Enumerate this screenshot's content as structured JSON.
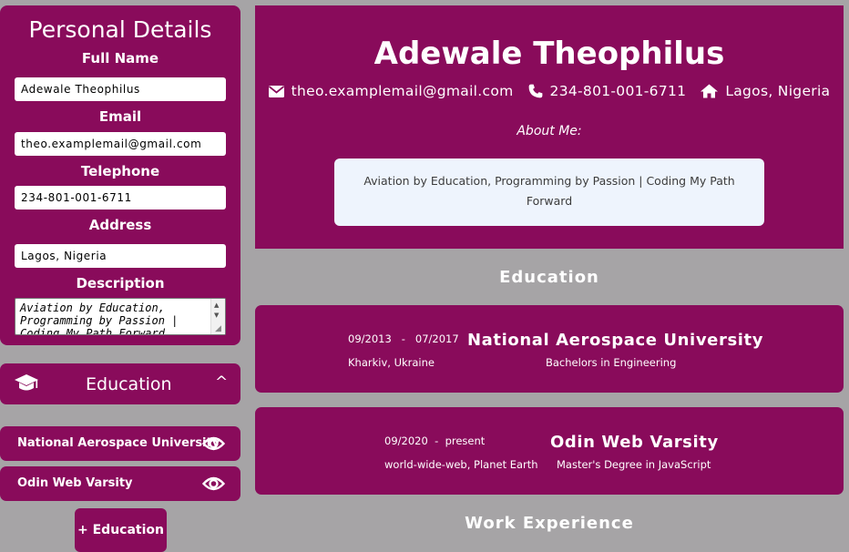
{
  "form": {
    "title": "Personal Details",
    "full_name_label": "Full Name",
    "full_name_value": "Adewale Theophilus",
    "email_label": "Email",
    "email_value": "theo.examplemail@gmail.com",
    "telephone_label": "Telephone",
    "telephone_value": "234-801-001-6711",
    "address_label": "Address",
    "address_value": "Lagos, Nigeria",
    "description_label": "Description",
    "description_value": "Aviation by Education, Programming by Passion | Coding My Path Forward"
  },
  "education_panel": {
    "header_label": "Education",
    "collapse_glyph": "^",
    "items": [
      {
        "label": "National Aerospace University"
      },
      {
        "label": "Odin Web Varsity"
      }
    ],
    "add_button_label": "+ Education"
  },
  "preview": {
    "name": "Adewale Theophilus",
    "email": "theo.examplemail@gmail.com",
    "phone": "234-801-001-6711",
    "address": "Lagos, Nigeria",
    "about_label": "About Me:",
    "about_text": "Aviation by Education, Programming by Passion | Coding My Path Forward",
    "education_title": "Education",
    "work_title": "Work Experience",
    "education": [
      {
        "start": "09/2013",
        "separator": "-",
        "end": "07/2017",
        "location": "Kharkiv, Ukraine",
        "school": "National Aerospace University",
        "degree": "Bachelors in Engineering"
      },
      {
        "start": "09/2020",
        "separator": "-",
        "end": "present",
        "location": "world-wide-web, Planet Earth",
        "school": "Odin Web Varsity",
        "degree": "Master's Degree in JavaScript"
      }
    ]
  },
  "colors": {
    "accent": "#890b5b",
    "page_background": "#a6a4a6",
    "about_box": "#eef4fd"
  },
  "icons": [
    "graduation-cap-icon",
    "eye-icon",
    "envelope-icon",
    "phone-icon",
    "home-icon"
  ]
}
